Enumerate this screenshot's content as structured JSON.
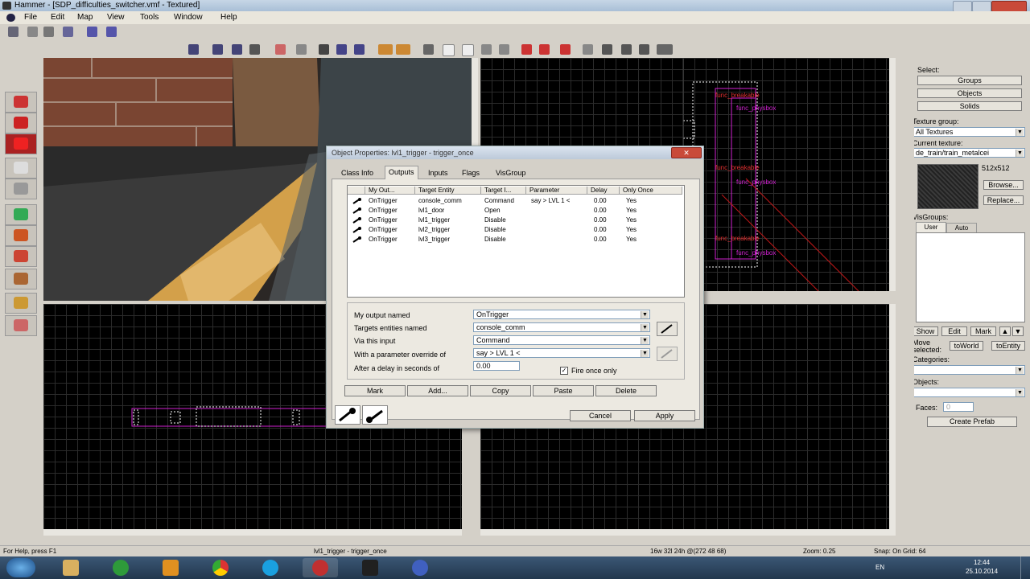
{
  "window": {
    "title": "Hammer - [SDP_difficulties_switcher.vmf - Textured]"
  },
  "menu": [
    "File",
    "Edit",
    "Map",
    "View",
    "Tools",
    "Window",
    "Help"
  ],
  "views": {
    "top_right_labels": [
      "func_physbox",
      "func_physbox",
      "func_physbox"
    ],
    "top_right_red_labels": [
      "func_breakable",
      "func_breakable",
      "func_breakable"
    ]
  },
  "dialog": {
    "title": "Object Properties: lvl1_trigger - trigger_once",
    "tabs": [
      "Class Info",
      "Outputs",
      "Inputs",
      "Flags",
      "VisGroup"
    ],
    "active_tab": "Outputs",
    "columns": [
      "My Out...",
      "Target Entity",
      "Target I...",
      "Parameter",
      "Delay",
      "Only Once"
    ],
    "rows": [
      [
        "OnTrigger",
        "console_comm",
        "Command",
        "say > LVL 1 <",
        "0.00",
        "Yes"
      ],
      [
        "OnTrigger",
        "lvl1_door",
        "Open",
        "",
        "0.00",
        "Yes"
      ],
      [
        "OnTrigger",
        "lvl1_trigger",
        "Disable",
        "",
        "0.00",
        "Yes"
      ],
      [
        "OnTrigger",
        "lvl2_trigger",
        "Disable",
        "",
        "0.00",
        "Yes"
      ],
      [
        "OnTrigger",
        "lvl3_trigger",
        "Disable",
        "",
        "0.00",
        "Yes"
      ]
    ],
    "form": {
      "output_label": "My output named",
      "output_value": "OnTrigger",
      "target_label": "Targets entities named",
      "target_value": "console_comm",
      "input_label": "Via this input",
      "input_value": "Command",
      "param_label": "With a parameter override of",
      "param_value": "say > LVL 1 <",
      "delay_label": "After a delay in seconds of",
      "delay_value": "0.00",
      "fire_once_label": "Fire once only"
    },
    "buttons": {
      "mark": "Mark",
      "add": "Add...",
      "copy": "Copy",
      "paste": "Paste",
      "delete": "Delete",
      "cancel": "Cancel",
      "apply": "Apply"
    }
  },
  "right_panel": {
    "select_label": "Select:",
    "groups": "Groups",
    "objects": "Objects",
    "solids": "Solids",
    "texture_group_label": "Texture group:",
    "texture_group": "All Textures",
    "current_texture_label": "Current texture:",
    "current_texture": "de_train/train_metalcei",
    "texture_size": "512x512",
    "browse": "Browse...",
    "replace": "Replace...",
    "visgroups_label": "VisGroups:",
    "visgroup_tabs": [
      "User",
      "Auto"
    ],
    "show": "Show",
    "edit": "Edit",
    "mark": "Mark",
    "move_selected": "Move selected:",
    "to_world": "toWorld",
    "to_entity": "toEntity",
    "categories_label": "Categories:",
    "objects_label": "Objects:",
    "faces_label": "Faces:",
    "faces_value": "0",
    "create_prefab": "Create Prefab"
  },
  "status": {
    "help": "For Help, press F1",
    "selection": "lvl1_trigger - trigger_once",
    "size": "16w 32l 24h @(272 48 68)",
    "zoom": "Zoom: 0.25",
    "snap": "Snap: On Grid: 64"
  },
  "taskbar": {
    "lang": "EN",
    "time": "12:44",
    "date": "25.10.2014"
  }
}
